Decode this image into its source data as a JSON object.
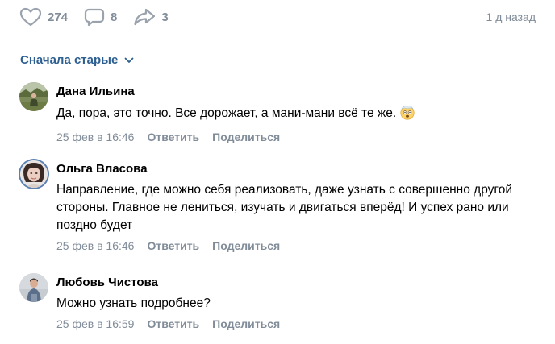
{
  "post_actions": {
    "likes": "274",
    "comments": "8",
    "shares": "3",
    "time": "1 д назад"
  },
  "sort": {
    "label": "Сначала старые"
  },
  "comments": [
    {
      "author": "Дана Ильина",
      "text": "Да, пора, это точно. Все дорожает, а мани-мани всё те же.",
      "emoji": "face-with-exploding-head-emoji",
      "date": "25 фев в 16:46",
      "reply": "Ответить",
      "share": "Поделиться"
    },
    {
      "author": "Ольга Власова",
      "text": "Направление, где можно себя реализовать, даже узнать с совершенно другой стороны. Главное не лениться, изучать и двигаться вперёд! И успех рано или поздно будет",
      "date": "25 фев в 16:46",
      "reply": "Ответить",
      "share": "Поделиться"
    },
    {
      "author": "Любовь Чистова",
      "text": "Можно узнать подробнее?",
      "date": "25 фев в 16:59",
      "reply": "Ответить",
      "share": "Поделиться"
    }
  ],
  "colors": {
    "accent_link": "#2d5f91",
    "muted": "#818c99",
    "divider": "#e7e8ec",
    "icon": "#99a2ad"
  }
}
